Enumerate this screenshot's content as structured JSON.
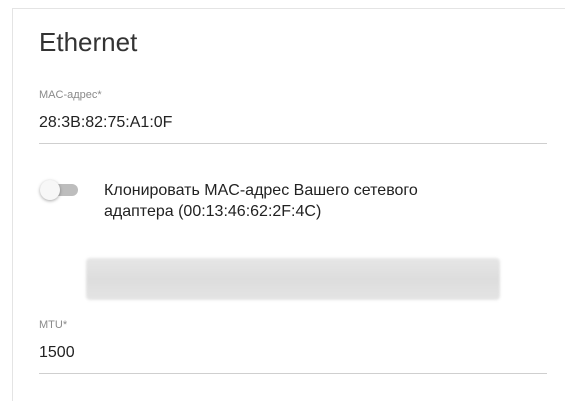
{
  "section": {
    "title": "Ethernet"
  },
  "mac": {
    "label": "MAC-адрес*",
    "value": "28:3B:82:75:A1:0F"
  },
  "clone": {
    "label_line1": "Клонировать MAC-адрес Вашего сетевого",
    "label_line2": "адаптера (00:13:46:62:2F:4C)",
    "enabled": false
  },
  "mtu": {
    "label": "MTU*",
    "value": "1500"
  },
  "colors": {
    "toggle_off_track": "#bdbdbd",
    "toggle_knob": "#f7f7f7",
    "divider": "#cfcfcf"
  }
}
